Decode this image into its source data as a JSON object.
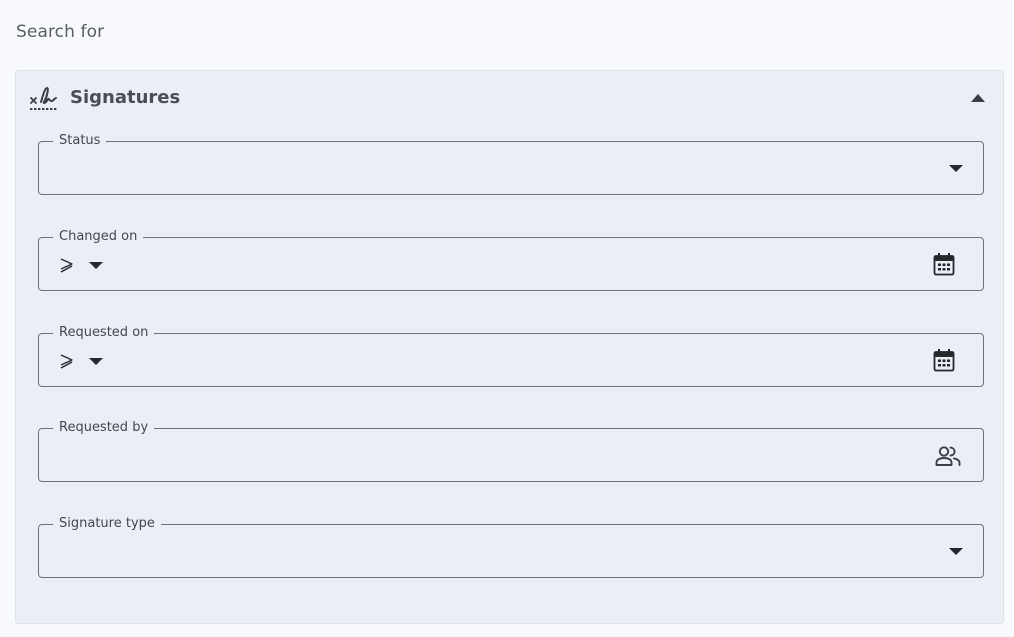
{
  "search": {
    "heading": "Search for"
  },
  "panel": {
    "title": "Signatures",
    "icon": "signature-icon",
    "expanded": true
  },
  "fields": {
    "status": {
      "label": "Status",
      "value": ""
    },
    "changed_on": {
      "label": "Changed on",
      "operator": "≥",
      "value": ""
    },
    "requested_on": {
      "label": "Requested on",
      "operator": "≥",
      "value": ""
    },
    "requested_by": {
      "label": "Requested by",
      "value": ""
    },
    "signature_type": {
      "label": "Signature type",
      "value": ""
    }
  },
  "colors": {
    "page_background": "#f7f9fd",
    "panel_background": "#ebeef5",
    "field_border": "#6e727a",
    "text": "#3c3f46"
  }
}
